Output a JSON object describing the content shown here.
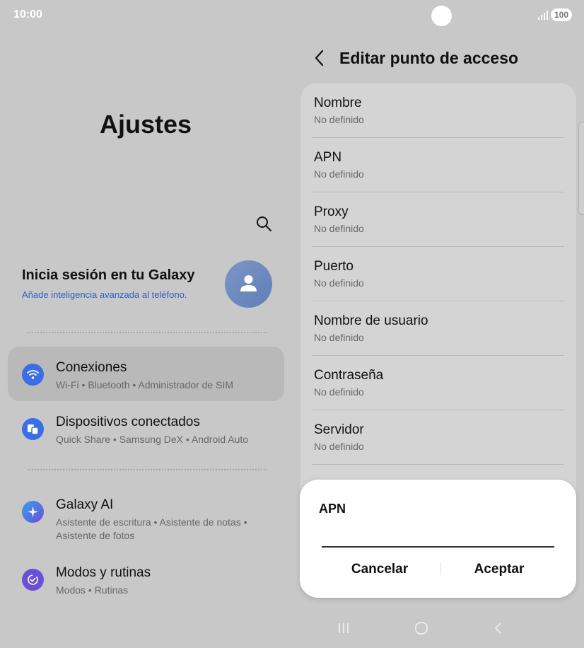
{
  "status_bar": {
    "time": "10:00",
    "battery": "100"
  },
  "settings": {
    "title": "Ajustes",
    "account": {
      "title": "Inicia sesión en tu Galaxy",
      "subtitle": "Añade inteligencia avanzada al teléfono."
    },
    "items": [
      {
        "title": "Conexiones",
        "subtitle": "Wi-Fi  •  Bluetooth  •  Administrador de SIM",
        "icon": "wifi-icon",
        "icon_color": "#3a6ee6"
      },
      {
        "title": "Dispositivos conectados",
        "subtitle": "Quick Share  •  Samsung DeX  •  Android Auto",
        "icon": "devices-icon",
        "icon_color": "#3a6ee6"
      },
      {
        "title": "Galaxy AI",
        "subtitle": "Asistente de escritura  •  Asistente de notas  •  Asistente de fotos",
        "icon": "sparkle-icon",
        "icon_color": "#4a5fd6"
      },
      {
        "title": "Modos y rutinas",
        "subtitle": "Modos  •  Rutinas",
        "icon": "check-circle-icon",
        "icon_color": "#6a4fd8"
      }
    ]
  },
  "apn_editor": {
    "title": "Editar punto de acceso",
    "fields": [
      {
        "label": "Nombre",
        "value": "No definido"
      },
      {
        "label": "APN",
        "value": "No definido"
      },
      {
        "label": "Proxy",
        "value": "No definido"
      },
      {
        "label": "Puerto",
        "value": "No definido"
      },
      {
        "label": "Nombre de usuario",
        "value": "No definido"
      },
      {
        "label": "Contraseña",
        "value": "No definido"
      },
      {
        "label": "Servidor",
        "value": "No definido"
      }
    ]
  },
  "dialog": {
    "title": "APN",
    "value": "",
    "cancel_label": "Cancelar",
    "ok_label": "Aceptar"
  }
}
